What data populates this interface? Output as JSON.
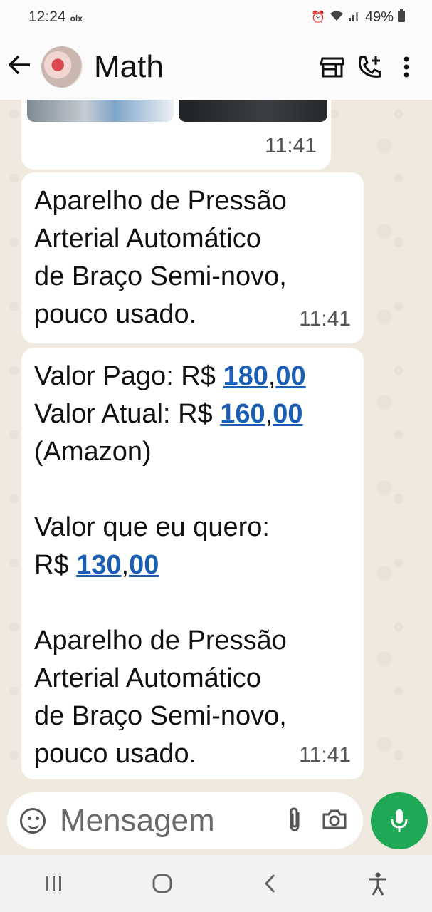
{
  "status_bar": {
    "time": "12:24",
    "notification_app": "olx",
    "battery": "49%"
  },
  "header": {
    "back_icon": "arrow-left-icon",
    "chat_title": "Math",
    "icons": [
      "store-icon",
      "add-call-icon",
      "more-vert-icon"
    ]
  },
  "messages": [
    {
      "type": "media",
      "time": "11:41"
    },
    {
      "type": "text",
      "text": "Aparelho de Pressão\nArterial Automático\nde Braço Semi-novo,\npouco usado.",
      "time": "11:41"
    },
    {
      "type": "text",
      "valor_pago_label": "Valor Pago: R$ ",
      "valor_pago_int": "180",
      "valor_pago_dec": "00",
      "valor_atual_label": "Valor Atual: R$ ",
      "valor_atual_int": "160",
      "valor_atual_dec": "00",
      "source": "(Amazon)",
      "quero_label": "Valor que eu quero:",
      "quero_prefix": "R$ ",
      "quero_int": "130",
      "quero_dec": "00",
      "description": "Aparelho de Pressão\nArterial Automático\nde Braço Semi-novo,\npouco usado.",
      "time": "11:41"
    }
  ],
  "composer": {
    "placeholder": "Mensagem",
    "icons": [
      "sticker-icon",
      "paperclip-icon",
      "camera-icon",
      "mic-icon"
    ]
  },
  "nav_bar": {
    "icons": [
      "recents-icon",
      "home-icon",
      "back-icon",
      "accessibility-icon"
    ]
  },
  "colors": {
    "chat_background": "#efe9df",
    "bubble": "#ffffff",
    "link": "#1a5fb4",
    "mic_button": "#1fa855"
  }
}
